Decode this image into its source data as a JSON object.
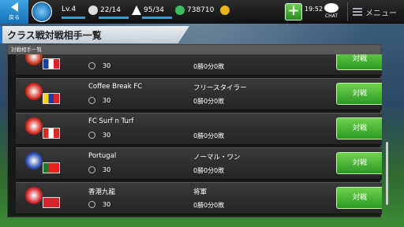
{
  "header": {
    "back_label": "戻る",
    "level": "Lv.4",
    "matches": "22/14",
    "stamina": "95/34",
    "money": "738710",
    "time": "19:52",
    "chat_label": "CHAT",
    "menu_label": "メニュー"
  },
  "page_title": "クラス戦対戦相手一覧",
  "panel_header": "対戦相手一覧",
  "rows": [
    {
      "name": "",
      "style": "",
      "level": "30",
      "record": "0勝0分0敗",
      "button": "対戦",
      "crest": "#c4321d",
      "flag": [
        "#1a3ea8",
        "#ffffff",
        "#d8252c"
      ]
    },
    {
      "name": "Coffee Break FC",
      "style": "フリースタイラー",
      "level": "30",
      "record": "0勝0分0敗",
      "button": "対戦",
      "crest": "#cf2b1c",
      "flag": [
        "#f6d21c",
        "#1f3ea5",
        "#d6262a"
      ]
    },
    {
      "name": "FC Surf n Turf",
      "style": "",
      "level": "30",
      "record": "0勝0分0敗",
      "button": "対戦",
      "crest": "#d62b23",
      "flag": [
        "#d72b27",
        "#ffffff",
        "#d72b27"
      ]
    },
    {
      "name": "Portugal",
      "style": "ノーマル・ワン",
      "level": "30",
      "record": "0勝0分0敗",
      "button": "対戦",
      "crest": "#2a4eb2",
      "flag": [
        "#1c7a35",
        "#e1241f",
        "#e1241f"
      ]
    },
    {
      "name": "香港九龍",
      "style": "将軍",
      "level": "30",
      "record": "0勝0分0敗",
      "button": "対戦",
      "crest": "#d3252b",
      "flag": [
        "#d3252b",
        "#d3252b",
        "#d3252b"
      ]
    }
  ],
  "colors": {
    "accent": "#2a78c6",
    "button_green": "#3aa82d"
  }
}
